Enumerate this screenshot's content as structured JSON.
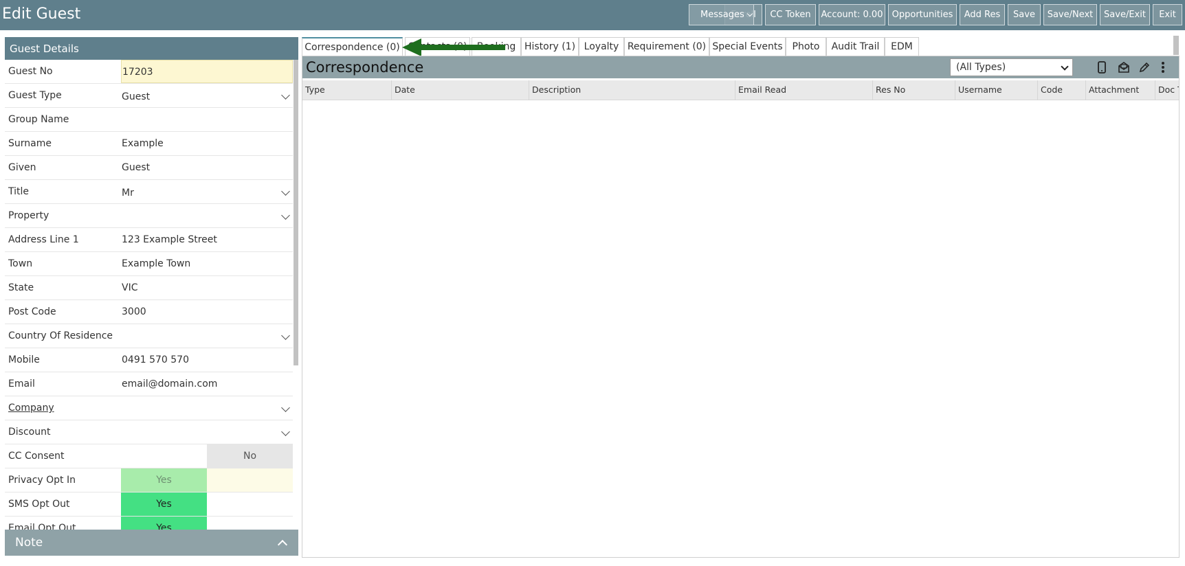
{
  "header": {
    "title": "Edit Guest",
    "buttons": {
      "messages": "Messages",
      "enroll": "Enroll",
      "cc_token": "CC Token",
      "account": "Account: 0.00",
      "opportunities": "Opportunities",
      "add_res": "Add Res",
      "save": "Save",
      "save_next": "Save/Next",
      "save_exit": "Save/Exit",
      "exit": "Exit"
    }
  },
  "guest_details": {
    "title": "Guest Details",
    "fields": {
      "guest_no": {
        "label": "Guest No",
        "value": "17203"
      },
      "guest_type": {
        "label": "Guest Type",
        "value": "Guest"
      },
      "group_name": {
        "label": "Group Name",
        "value": ""
      },
      "surname": {
        "label": "Surname",
        "value": "Example"
      },
      "given": {
        "label": "Given",
        "value": "Guest"
      },
      "title": {
        "label": "Title",
        "value": "Mr"
      },
      "property": {
        "label": "Property",
        "value": ""
      },
      "address1": {
        "label": "Address Line 1",
        "value": "123 Example Street"
      },
      "town": {
        "label": "Town",
        "value": "Example Town"
      },
      "state": {
        "label": "State",
        "value": "VIC"
      },
      "postcode": {
        "label": "Post Code",
        "value": "3000"
      },
      "country": {
        "label": "Country Of Residence",
        "value": ""
      },
      "mobile": {
        "label": "Mobile",
        "value": "0491 570 570"
      },
      "email": {
        "label": "Email",
        "value": "email@domain.com"
      },
      "company": {
        "label": "Company",
        "value": ""
      },
      "discount": {
        "label": "Discount",
        "value": ""
      },
      "cc_consent": {
        "label": "CC Consent",
        "value": "No"
      },
      "privacy_opt_in": {
        "label": "Privacy Opt In",
        "yes": "Yes"
      },
      "sms_opt_out": {
        "label": "SMS Opt Out",
        "yes": "Yes"
      },
      "email_opt_out": {
        "label": "Email Opt Out",
        "yes": "Yes"
      }
    }
  },
  "note": {
    "label": "Note"
  },
  "tabs": {
    "correspondence": "Correspondence (0)",
    "tab2": "Contacts (0)",
    "booking": "Booking",
    "history": "History (1)",
    "loyalty": "Loyalty",
    "requirement": "Requirement (0)",
    "special_events": "Special Events",
    "photo": "Photo",
    "audit_trail": "Audit Trail",
    "edm": "EDM"
  },
  "correspondence": {
    "title": "Correspondence",
    "filter_value": "(All Types)",
    "columns": {
      "type": "Type",
      "date": "Date",
      "description": "Description",
      "email_read": "Email Read",
      "res_no": "Res No",
      "username": "Username",
      "code": "Code",
      "attachment": "Attachment",
      "doc_type": "Doc Type"
    }
  },
  "colors": {
    "header_bg": "#5f7f8c",
    "button_bg": "#7d959e",
    "section_bg": "#8fa2a7",
    "highlight_field": "#fdf7d2",
    "toggle_green": "#44e083",
    "toggle_green_light": "#a8ecab",
    "arrow_green": "#1e6e1e"
  }
}
